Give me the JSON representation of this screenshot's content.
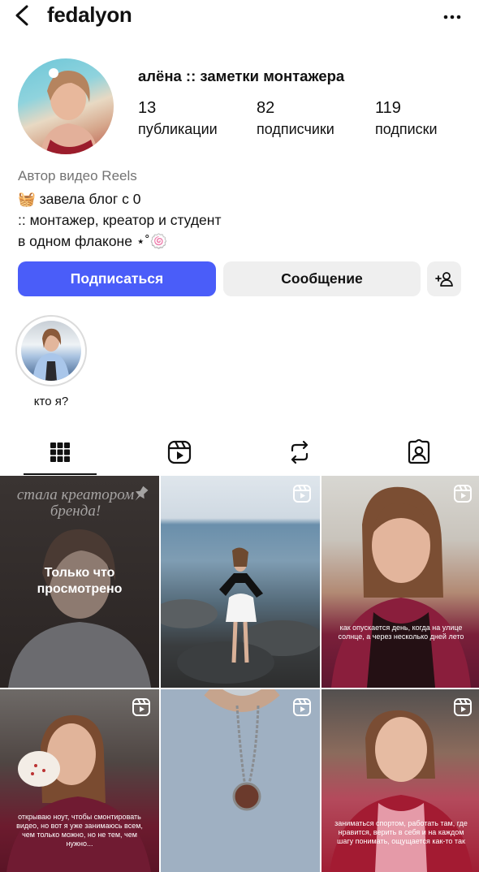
{
  "header": {
    "username": "fedalyon",
    "back_icon": "chevron-left-icon",
    "more_icon": "more-horizontal-icon"
  },
  "profile": {
    "display_name": "алёна :: заметки монтажера",
    "stats": {
      "posts": {
        "value": "13",
        "label": "публикации"
      },
      "followers": {
        "value": "82",
        "label": "подписчики"
      },
      "following": {
        "value": "119",
        "label": "подписки"
      }
    },
    "category": "Автор видео Reels",
    "bio_lines": [
      "🧺 завела блог с 0",
      ":: монтажер, креатор и студент",
      "в одном флаконе ⋆˚🍥"
    ]
  },
  "actions": {
    "follow_label": "Подписаться",
    "message_label": "Сообщение",
    "add_icon": "add-user-icon"
  },
  "highlights": [
    {
      "label": "кто я?"
    }
  ],
  "tabs": [
    {
      "icon": "grid-icon",
      "active": true
    },
    {
      "icon": "reels-icon",
      "active": false
    },
    {
      "icon": "repost-icon",
      "active": false
    },
    {
      "icon": "tagged-icon",
      "active": false
    }
  ],
  "posts": {
    "p1": {
      "title_line1": "стала креатором",
      "title_line2": "бренда!",
      "overlay": "Только что просмотрено"
    },
    "p3": {
      "caption": "как опускается день, когда на улице солнце, а через несколько дней лето"
    },
    "p4": {
      "caption": "открываю ноут, чтобы смонтировать видео, но вот я уже занимаюсь всем, чем только можно, но не тем, чем нужно..."
    },
    "p6": {
      "caption": "заниматься спортом, работать там, где нравится, верить в себя и на каждом шагу понимать, ощущается как-то так"
    }
  },
  "colors": {
    "accent": "#4a5df9",
    "secondary_button": "#efefef",
    "muted_text": "#737373"
  }
}
